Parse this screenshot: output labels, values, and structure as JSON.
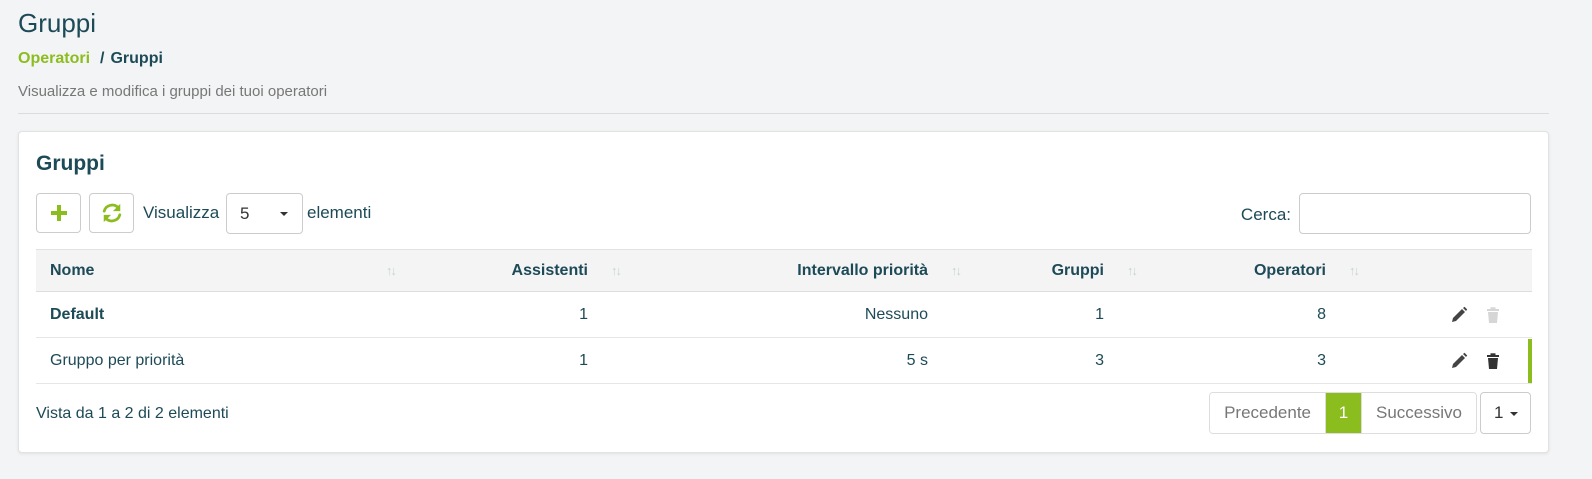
{
  "header": {
    "title": "Gruppi",
    "breadcrumb": {
      "parent": "Operatori",
      "separator": "/",
      "current": "Gruppi"
    },
    "subtitle": "Visualizza e modifica i gruppi dei tuoi operatori"
  },
  "card": {
    "title": "Gruppi",
    "toolbar": {
      "add_icon": "plus-icon",
      "refresh_icon": "refresh-icon",
      "show_label": "Visualizza",
      "length_value": "5",
      "items_label": "elementi",
      "search_label": "Cerca:",
      "search_value": "",
      "search_placeholder": ""
    },
    "table": {
      "columns": [
        "Nome",
        "Assistenti",
        "Intervallo priorità",
        "Gruppi",
        "Operatori"
      ],
      "sort_glyph": "↑↓",
      "rows": [
        {
          "name": "Default",
          "assistants": "1",
          "priority_range": "Nessuno",
          "groups": "1",
          "operators": "8",
          "bold": true,
          "delete_enabled": false
        },
        {
          "name": "Gruppo per priorità",
          "assistants": "1",
          "priority_range": "5 s",
          "groups": "3",
          "operators": "3",
          "bold": false,
          "delete_enabled": true
        }
      ]
    },
    "footer": {
      "info": "Vista da 1 a 2 di 2 elementi",
      "prev_label": "Precedente",
      "current_page": "1",
      "next_label": "Successivo",
      "page_select_value": "1"
    }
  },
  "colors": {
    "accent": "#8cbd1f",
    "text": "#1d4a57",
    "muted": "#777777"
  }
}
